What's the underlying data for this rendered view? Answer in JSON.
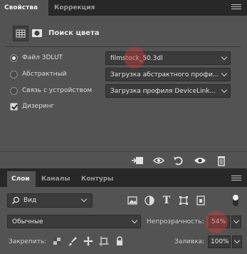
{
  "properties_panel": {
    "tabs": [
      {
        "label": "Свойства",
        "active": true
      },
      {
        "label": "Коррекция",
        "active": false
      }
    ],
    "title": "Поиск цвета",
    "options": [
      {
        "label": "Файл 3DLUT",
        "selected": true,
        "value": "filmstock_50.3dl"
      },
      {
        "label": "Абстрактный",
        "selected": false,
        "value": "Загрузка абстрактного профи..."
      },
      {
        "label": "Связь с устройством",
        "selected": false,
        "value": "Загрузка профиля DeviceLink..."
      }
    ],
    "dither": {
      "label": "Дизеринг",
      "checked": true
    }
  },
  "layers_panel": {
    "tabs": [
      {
        "label": "Слои",
        "active": true
      },
      {
        "label": "Каналы",
        "active": false
      },
      {
        "label": "Контуры",
        "active": false
      }
    ],
    "filter_kind": "Вид",
    "blend_mode": "Обычные",
    "opacity_label": "Непрозрачность:",
    "opacity_value": "54%",
    "lock_label": "Закрепить:",
    "fill_label": "Заливка:",
    "fill_value": "100%"
  },
  "colors": {
    "panel_bg": "#535353",
    "tabbar_bg": "#282828",
    "highlight": "#c83c3c"
  }
}
